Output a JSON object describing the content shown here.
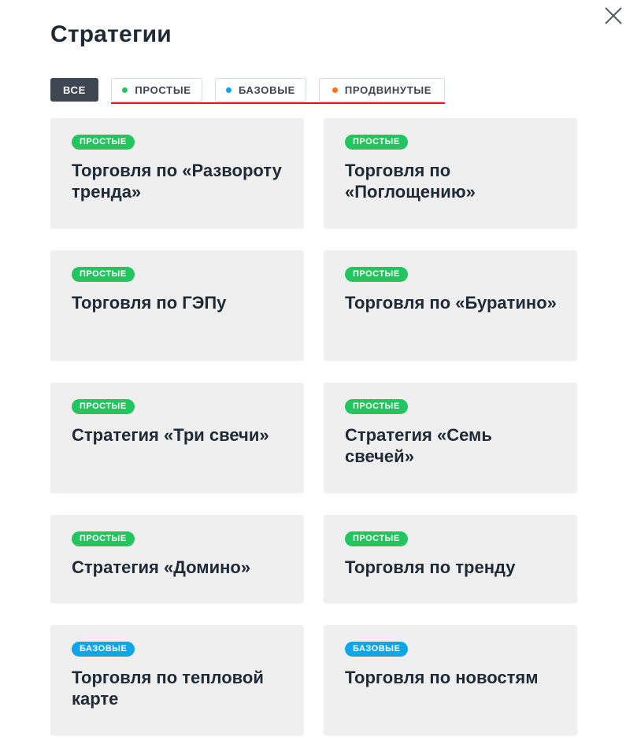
{
  "page": {
    "title": "Стратегии"
  },
  "filters": [
    {
      "label": "ВСЕ",
      "active": true
    },
    {
      "label": "ПРОСТЫЕ",
      "dot_color": "#22c55e"
    },
    {
      "label": "БАЗОВЫЕ",
      "dot_color": "#0ea5e9"
    },
    {
      "label": "ПРОДВИНУТЫЕ",
      "dot_color": "#f97316"
    }
  ],
  "colors": {
    "simple_badge": "#22c55e",
    "basic_badge": "#0ea5e9",
    "advanced_dot": "#f97316",
    "active_filter_bg": "#3d4651",
    "underline": "#e0101b",
    "card_bg": "#efefef"
  },
  "icons": {
    "close": "close-icon"
  },
  "cards": [
    {
      "badge": "ПРОСТЫЕ",
      "title": "Торговля по «Развороту тренда»"
    },
    {
      "badge": "ПРОСТЫЕ",
      "title": "Торговля по «Поглощению»"
    },
    {
      "badge": "ПРОСТЫЕ",
      "title": "Торговля по ГЭПу"
    },
    {
      "badge": "ПРОСТЫЕ",
      "title": "Торговля по «Буратино»"
    },
    {
      "badge": "ПРОСТЫЕ",
      "title": "Стратегия «Три свечи»"
    },
    {
      "badge": "ПРОСТЫЕ",
      "title": "Стратегия «Семь свечей»"
    },
    {
      "badge": "ПРОСТЫЕ",
      "title": "Стратегия «Домино»"
    },
    {
      "badge": "ПРОСТЫЕ",
      "title": "Торговля по тренду"
    },
    {
      "badge": "БАЗОВЫЕ",
      "title": "Торговля по тепловой карте"
    },
    {
      "badge": "БАЗОВЫЕ",
      "title": "Торговля по новостям"
    }
  ]
}
